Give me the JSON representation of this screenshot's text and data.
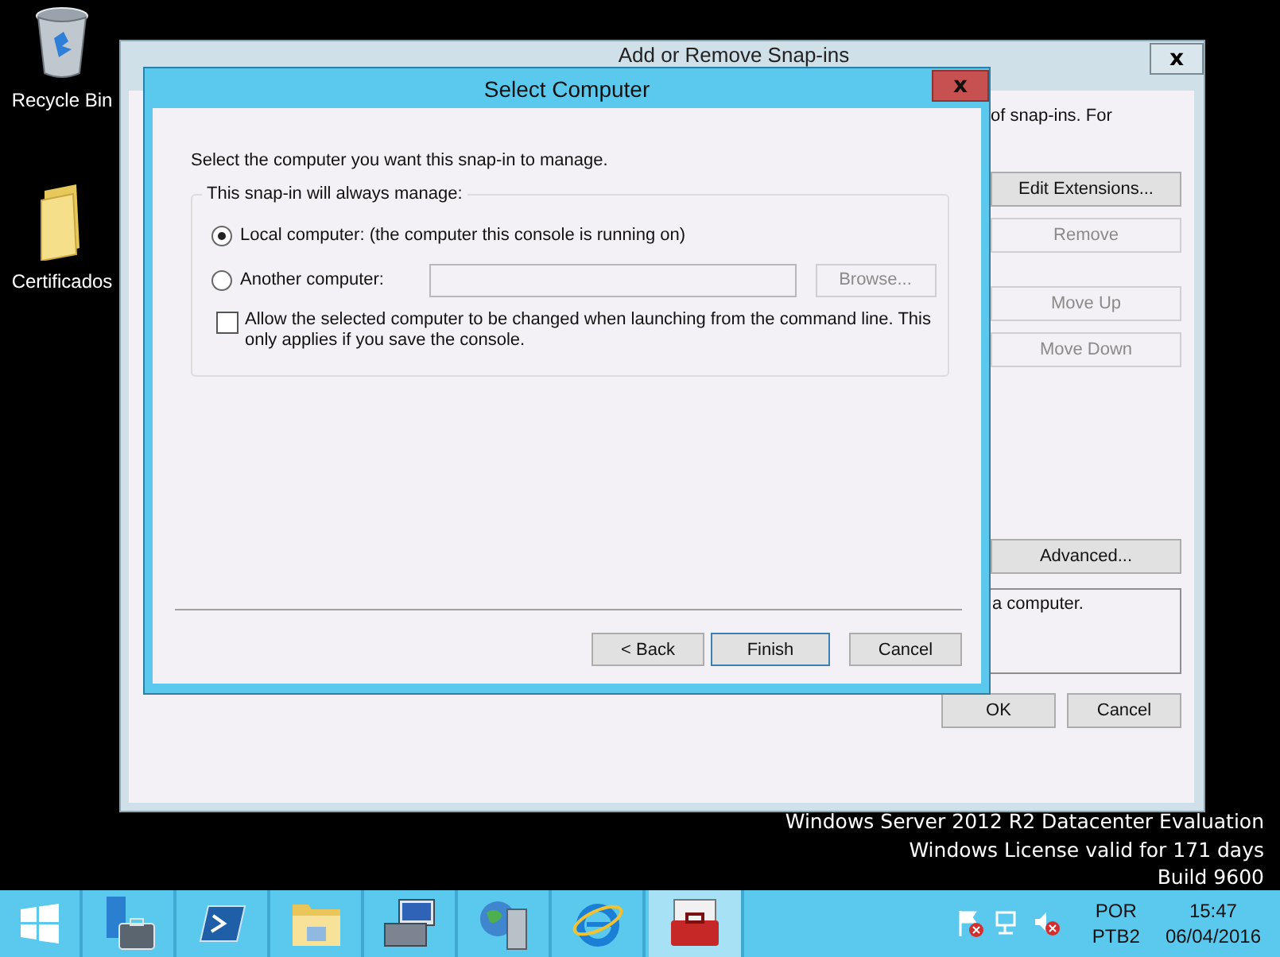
{
  "desktop_icons": [
    {
      "kind": "recycle",
      "label": "Recycle Bin"
    },
    {
      "kind": "folder",
      "label": "Certificados"
    }
  ],
  "background_window": {
    "title": "Add or Remove Snap-ins",
    "close": "x",
    "text_fragment": "of snap-ins. For",
    "side_buttons": [
      {
        "label": "Edit Extensions...",
        "disabled": false
      },
      {
        "label": "Remove",
        "disabled": true
      },
      {
        "label": "Move Up",
        "disabled": true
      },
      {
        "label": "Move Down",
        "disabled": true
      },
      {
        "label": "Advanced...",
        "disabled": false
      }
    ],
    "description_fragment": "a computer.",
    "footer_buttons": [
      "OK",
      "Cancel"
    ]
  },
  "dialog": {
    "title": "Select Computer",
    "close": "x",
    "instruction": "Select the computer you want this snap-in to manage.",
    "group_label": "This snap-in will always manage:",
    "options": [
      {
        "label": "Local computer:  (the computer this console is running on)",
        "selected": true,
        "kind": "plain"
      },
      {
        "label": "Another computer:",
        "selected": false,
        "kind": "with-field"
      }
    ],
    "browse_button": {
      "label": "Browse...",
      "disabled": true
    },
    "allow_change": {
      "label": "Allow the selected computer to be changed when launching from the command line.  This only applies if you save the console.",
      "checked": false
    },
    "buttons": [
      {
        "label": "< Back",
        "default": false
      },
      {
        "label": "Finish",
        "default": true
      },
      {
        "label": "Cancel",
        "default": false
      }
    ]
  },
  "watermark_lines": [
    "Windows Server 2012 R2 Datacenter Evaluation",
    "Windows License valid for 171 days",
    "Build 9600"
  ],
  "taskbar": {
    "apps": [
      {
        "kind": "start",
        "selected": false
      },
      {
        "kind": "server-manager",
        "selected": false
      },
      {
        "kind": "powershell",
        "selected": false
      },
      {
        "kind": "explorer",
        "selected": false
      },
      {
        "kind": "computer-tools",
        "selected": false
      },
      {
        "kind": "globe-server",
        "selected": false
      },
      {
        "kind": "browser",
        "selected": false
      },
      {
        "kind": "toolbox",
        "selected": true
      }
    ],
    "language": [
      "POR",
      "PTB2"
    ],
    "time": "15:47",
    "date": "06/04/2016"
  }
}
